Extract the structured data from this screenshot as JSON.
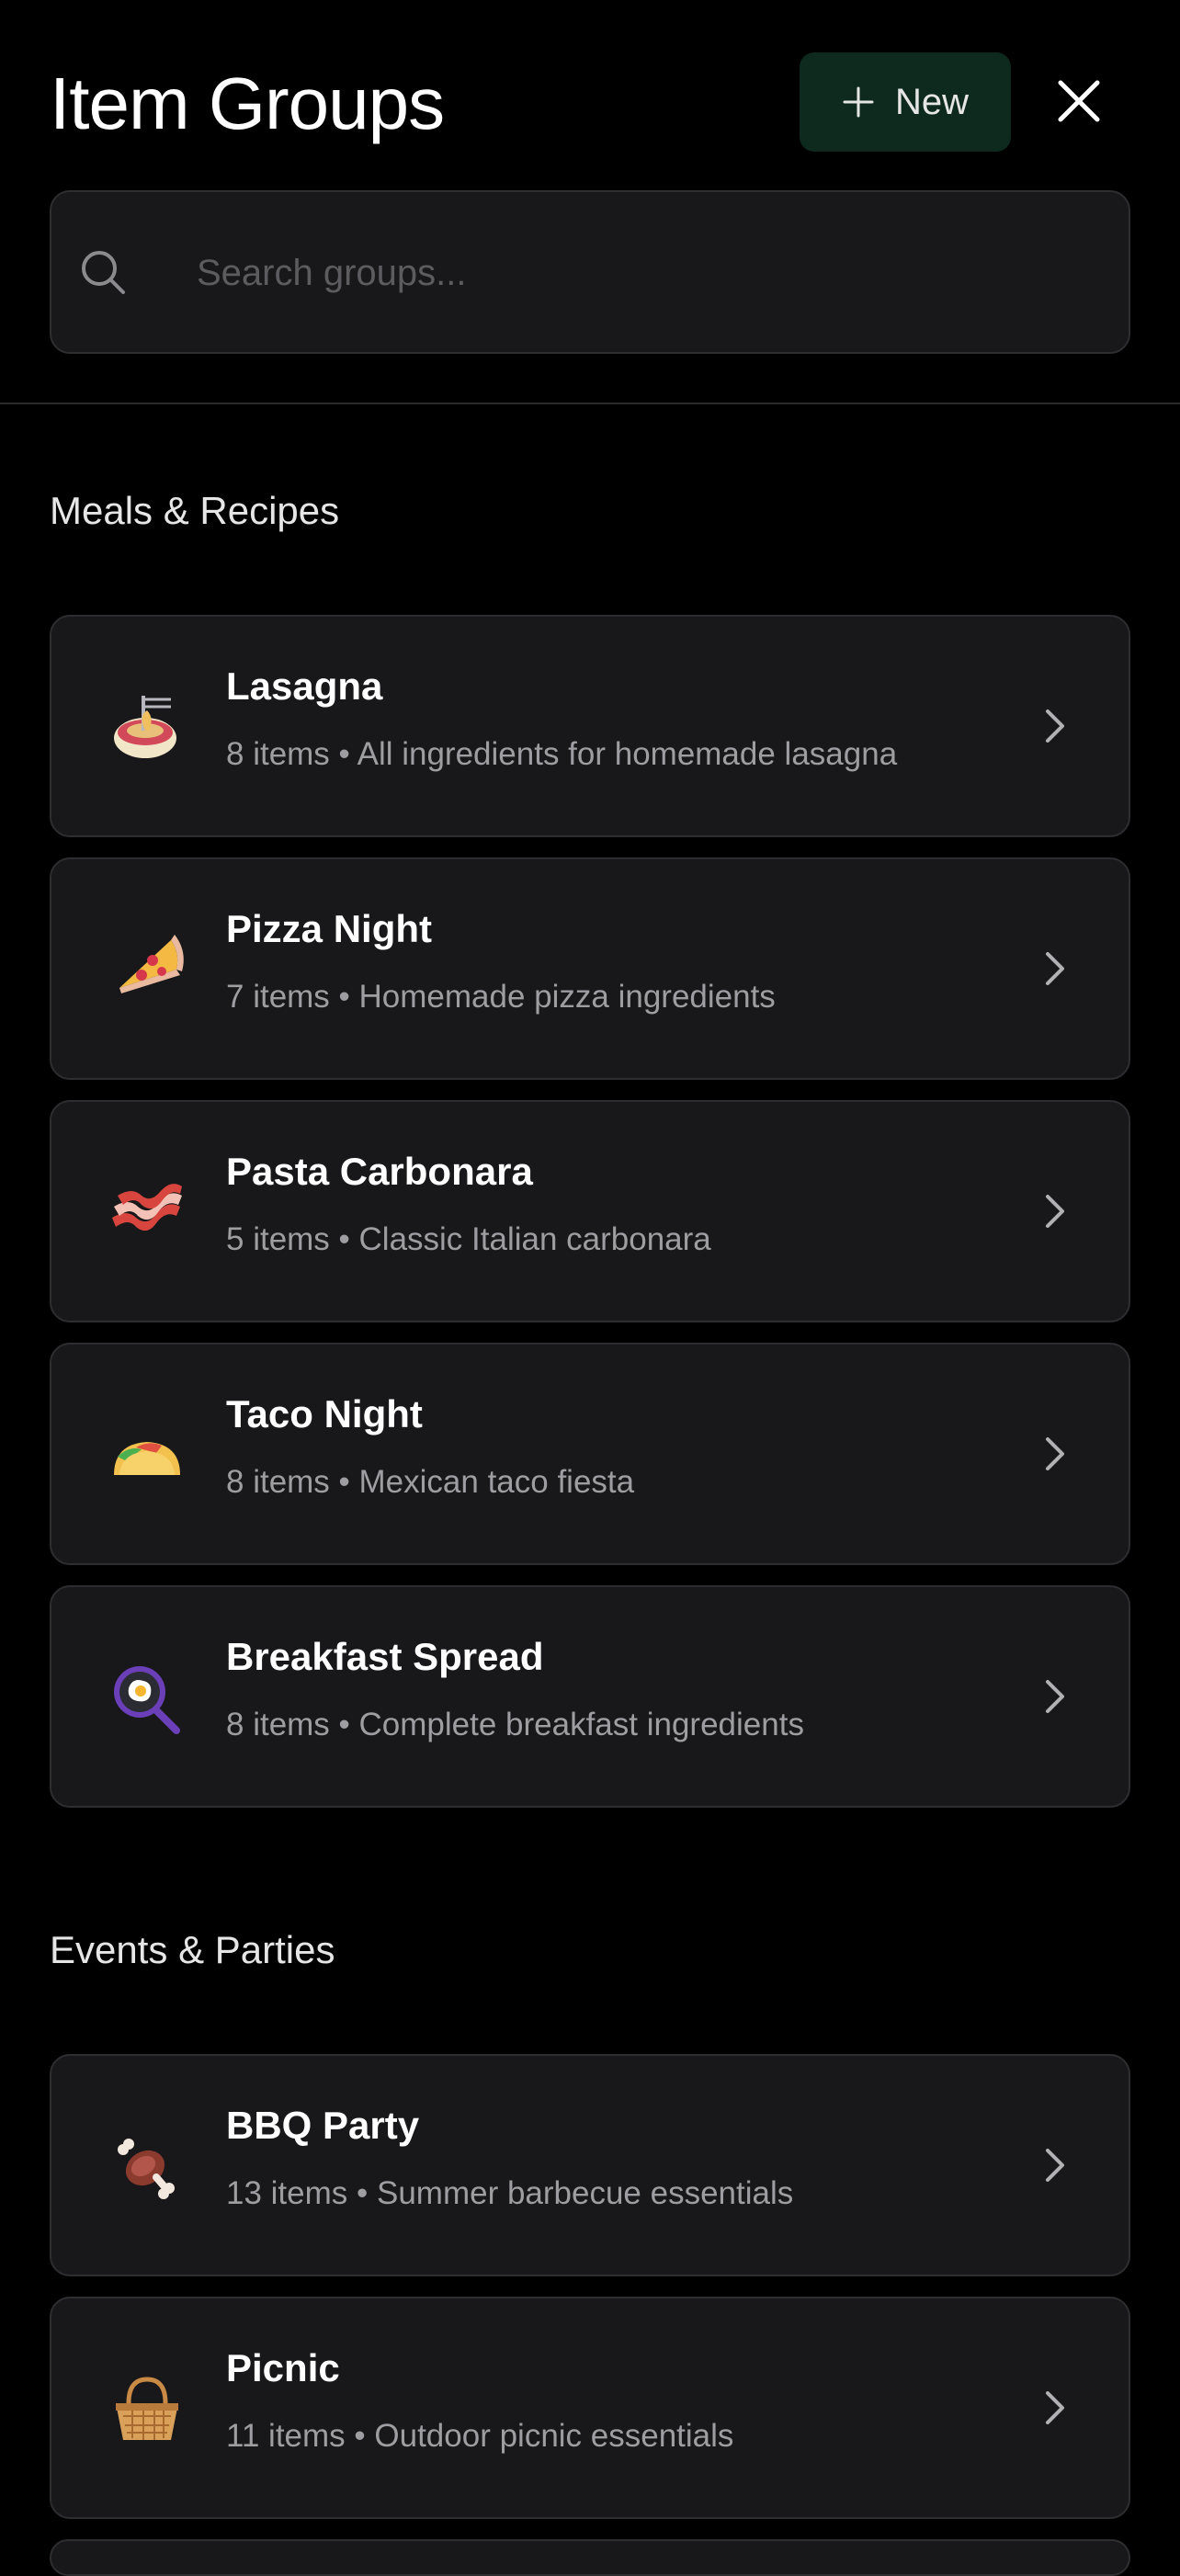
{
  "header": {
    "title": "Item Groups",
    "new_label": "New"
  },
  "search": {
    "placeholder": "Search groups..."
  },
  "sections": [
    {
      "title": "Meals & Recipes",
      "items": [
        {
          "name": "Lasagna",
          "count": "8 items",
          "description": "All ingredients for homemade lasagna",
          "icon": "spaghetti-icon"
        },
        {
          "name": "Pizza Night",
          "count": "7 items",
          "description": "Homemade pizza ingredients",
          "icon": "pizza-icon"
        },
        {
          "name": "Pasta Carbonara",
          "count": "5 items",
          "description": "Classic Italian carbonara",
          "icon": "bacon-icon"
        },
        {
          "name": "Taco Night",
          "count": "8 items",
          "description": "Mexican taco fiesta",
          "icon": "taco-icon"
        },
        {
          "name": "Breakfast Spread",
          "count": "8 items",
          "description": "Complete breakfast ingredients",
          "icon": "frying-pan-icon"
        }
      ]
    },
    {
      "title": "Events & Parties",
      "items": [
        {
          "name": "BBQ Party",
          "count": "13 items",
          "description": "Summer barbecue essentials",
          "icon": "meat-on-bone-icon"
        },
        {
          "name": "Picnic",
          "count": "11 items",
          "description": "Outdoor picnic essentials",
          "icon": "basket-icon"
        }
      ]
    }
  ],
  "colors": {
    "background": "#000000",
    "card": "#18181a",
    "accent_button": "#0e2a1f",
    "subtext": "#9d9da2"
  }
}
